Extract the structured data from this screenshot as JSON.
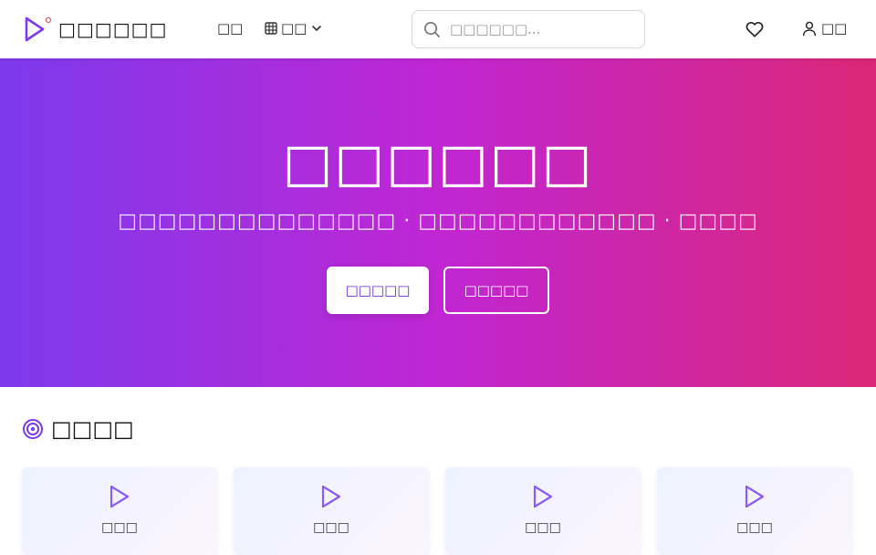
{
  "colors": {
    "brand_purple": "#7c3aed",
    "hero_gradient_start": "#7c3aed",
    "hero_gradient_mid": "#c026d3",
    "hero_gradient_end": "#db2777",
    "logo_dot": "#e53935"
  },
  "header": {
    "logo_icon": "play-triangle-icon",
    "logo_text": "□□□□□□",
    "nav": {
      "home_label": "□□",
      "category_label": "□□",
      "category_icon": "grid-icon",
      "category_chevron": "chevron-down-icon"
    },
    "search": {
      "icon": "search-icon",
      "placeholder": "□□□□□□...",
      "value": ""
    },
    "favorite_icon": "heart-icon",
    "login": {
      "icon": "user-icon",
      "label": "□□"
    }
  },
  "hero": {
    "title": "□□□□□□",
    "subtitle": "□□□□□□□□□□□□□□ · □□□□□□□□□□□□ · □□□□",
    "primary_button": "□□□□□",
    "secondary_button": "□□□□□"
  },
  "section": {
    "icon": "target-icon",
    "title": "□□□□",
    "cards": [
      {
        "icon": "play-icon",
        "label": "□□□"
      },
      {
        "icon": "play-icon",
        "label": "□□□"
      },
      {
        "icon": "play-icon",
        "label": "□□□"
      },
      {
        "icon": "play-icon",
        "label": "□□□"
      }
    ]
  }
}
